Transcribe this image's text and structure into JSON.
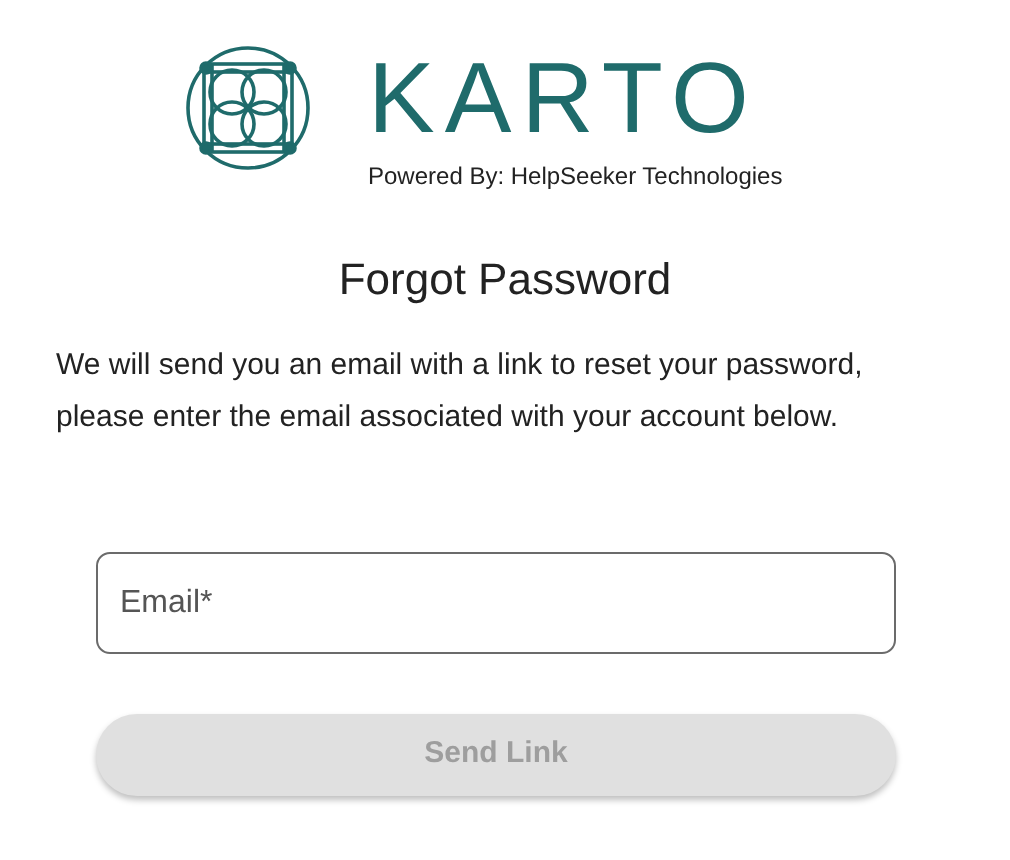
{
  "logo": {
    "wordmark": "KARTO",
    "tagline": "Powered By: HelpSeeker Technologies"
  },
  "title": "Forgot Password",
  "description": "We will send you an email with a link to reset your password, please enter the email associated with your account below.",
  "email_field": {
    "placeholder": "Email*"
  },
  "send_button": {
    "label": "Send Link",
    "disabled": true
  }
}
